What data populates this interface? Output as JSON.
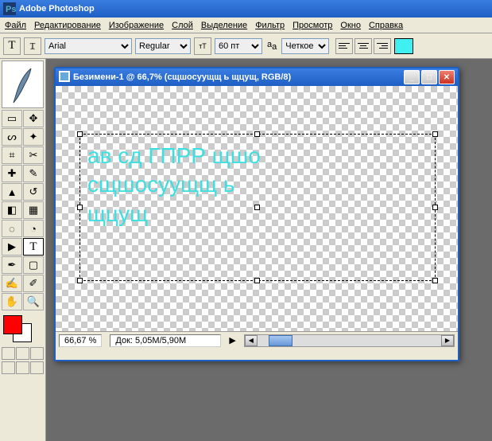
{
  "app": {
    "title": "Adobe Photoshop"
  },
  "menu": {
    "file": "Файл",
    "edit": "Редактирование",
    "image": "Изображение",
    "layer": "Слой",
    "select": "Выделение",
    "filter": "Фильтр",
    "view": "Просмотр",
    "window": "Окно",
    "help": "Справка"
  },
  "options": {
    "font": "Arial",
    "weight": "Regular",
    "size": "60 пт",
    "aa": "Четкое",
    "swatch": "#40f0f0"
  },
  "doc": {
    "title": "Безимени-1 @ 66,7% (сщшосуущщ ь щцущ, RGB/8)",
    "zoom": "66,67 %",
    "docsize": "Док: 5,05M/5,90M"
  },
  "text": {
    "content": "ав сд ГПРР щшо\nсщшосуущщ ь\nщцущ",
    "color": "#3ce0e0"
  },
  "colors": {
    "fg": "#ff0000",
    "bg": "#ffffff"
  }
}
